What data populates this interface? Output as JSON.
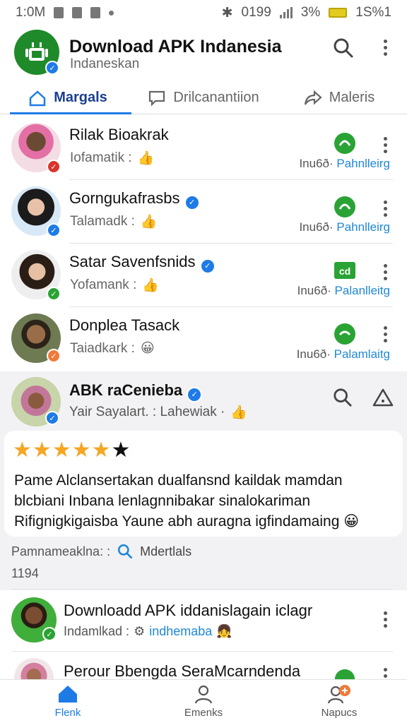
{
  "status_bar": {
    "time": "1:0M",
    "network": "0199",
    "battery_pct": "3%",
    "clock_right": "1S%1"
  },
  "header": {
    "title": "Download APK Indanesia",
    "subtitle": "Indaneskan",
    "icons": [
      "android-logo-icon",
      "verified-icon",
      "search-icon",
      "more-vert-icon"
    ]
  },
  "tabs": [
    {
      "label": "Margals",
      "icon": "home-icon",
      "active": true
    },
    {
      "label": "Drilcanantiion",
      "icon": "chat-bubble-icon",
      "active": false
    },
    {
      "label": "Maleris",
      "icon": "share-icon",
      "active": false
    }
  ],
  "apps": [
    {
      "name": "Rilak Bioakrak",
      "meta": "Iofamatik :",
      "foot_label": "Inu6ð·",
      "foot_value": "Pahnlleirg",
      "badge": "red"
    },
    {
      "name": "Gorngukafrasbs",
      "meta": "Talamadk :",
      "foot_label": "Inu6ð·",
      "foot_value": "Pahnlleirg",
      "badge": "blue",
      "verified": true
    },
    {
      "name": "Satar Savenfsnids",
      "meta": "Yofamank :",
      "foot_label": "Inu6ð·",
      "foot_value": "Palanlleitg",
      "badge": "green",
      "verified": true
    },
    {
      "name": "Donplea Tasack",
      "meta": "Taiadkark :",
      "foot_label": "Inu6ð·",
      "foot_value": "Palamlaitg",
      "badge": "orange"
    }
  ],
  "review": {
    "author": "ABK  raCenieba",
    "meta": "Yair Sayalart. :  Lahewiak ·",
    "rating": 5,
    "max_rating": 6,
    "text": "Pame Alclansertakan dualfansnd kaildak mamdan blcbiani Inbana lenlagnnibakar sinalokariman Rifignigkigaisba Yaune abh auragna igfindamaing",
    "stats_label": "Pamnameaklna: :",
    "stats_link": "Mdertlals",
    "count": "1194"
  },
  "more_apps": [
    {
      "name": "Downloadd APK iddanislagain iclagr",
      "meta": "Indamlkad :",
      "meta_link": "indhemaba"
    },
    {
      "name": "Perour Bbengda SeraMcarndenda"
    }
  ],
  "bottom_nav": [
    {
      "label": "Flenk",
      "icon": "home-icon",
      "active": true
    },
    {
      "label": "Emenks",
      "icon": "person-icon",
      "active": false
    },
    {
      "label": "Napucs",
      "icon": "add-friend-icon",
      "active": false
    }
  ],
  "colors": {
    "accent": "#1e7be6",
    "brand_green": "#1f8a2a",
    "star": "#f5a623",
    "link": "#1e88d8"
  }
}
